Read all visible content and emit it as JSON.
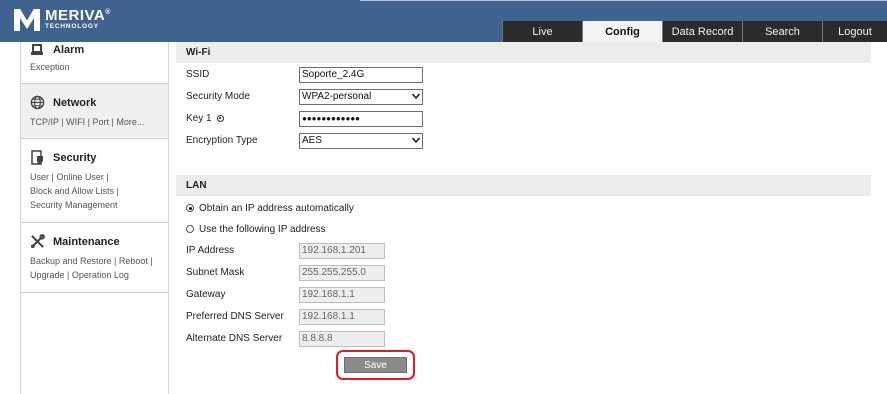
{
  "brand": {
    "name": "MERIVA",
    "sub": "TECHNOLOGY",
    "reg": "®"
  },
  "tabs": [
    {
      "label": "Live"
    },
    {
      "label": "Config",
      "active": true
    },
    {
      "label": "Data Record"
    },
    {
      "label": "Search"
    },
    {
      "label": "Logout"
    }
  ],
  "sidebar": {
    "items": [
      {
        "title": "Alarm",
        "icon": "alarm-icon",
        "sub": [
          "Exception"
        ]
      },
      {
        "title": "Network",
        "icon": "globe-icon",
        "sub": [
          "TCP/IP | WIFI | Port | More..."
        ],
        "active": true
      },
      {
        "title": "Security",
        "icon": "shield-icon",
        "sub": [
          "User | Online User |",
          "Block and Allow Lists |",
          "Security Management"
        ]
      },
      {
        "title": "Maintenance",
        "icon": "wrench-icon",
        "sub": [
          "Backup and Restore | Reboot |",
          "Upgrade | Operation Log"
        ]
      }
    ]
  },
  "wifi": {
    "header": "Wi-Fi",
    "ssid_label": "SSID",
    "ssid_value": "Soporte_2.4G",
    "security_mode_label": "Security Mode",
    "security_mode_value": "WPA2-personal",
    "key_label": "Key 1",
    "key_value": "●●●●●●●●●●●●",
    "encryption_label": "Encryption Type",
    "encryption_value": "AES"
  },
  "lan": {
    "header": "LAN",
    "auto_label": "Obtain an IP address automatically",
    "manual_label": "Use the following IP address",
    "selected": "auto",
    "ip_label": "IP Address",
    "ip_value": "192.168.1.201",
    "mask_label": "Subnet Mask",
    "mask_value": "255.255.255.0",
    "gateway_label": "Gateway",
    "gateway_value": "192.168.1.1",
    "dns1_label": "Preferred DNS Server",
    "dns1_value": "192.168.1.1",
    "dns2_label": "Alternate DNS Server",
    "dns2_value": "8.8.8.8"
  },
  "save_label": "Save",
  "colors": {
    "topbar": "#3f628e",
    "tab_dark": "#2b2b2b",
    "highlight": "#e11b22"
  }
}
